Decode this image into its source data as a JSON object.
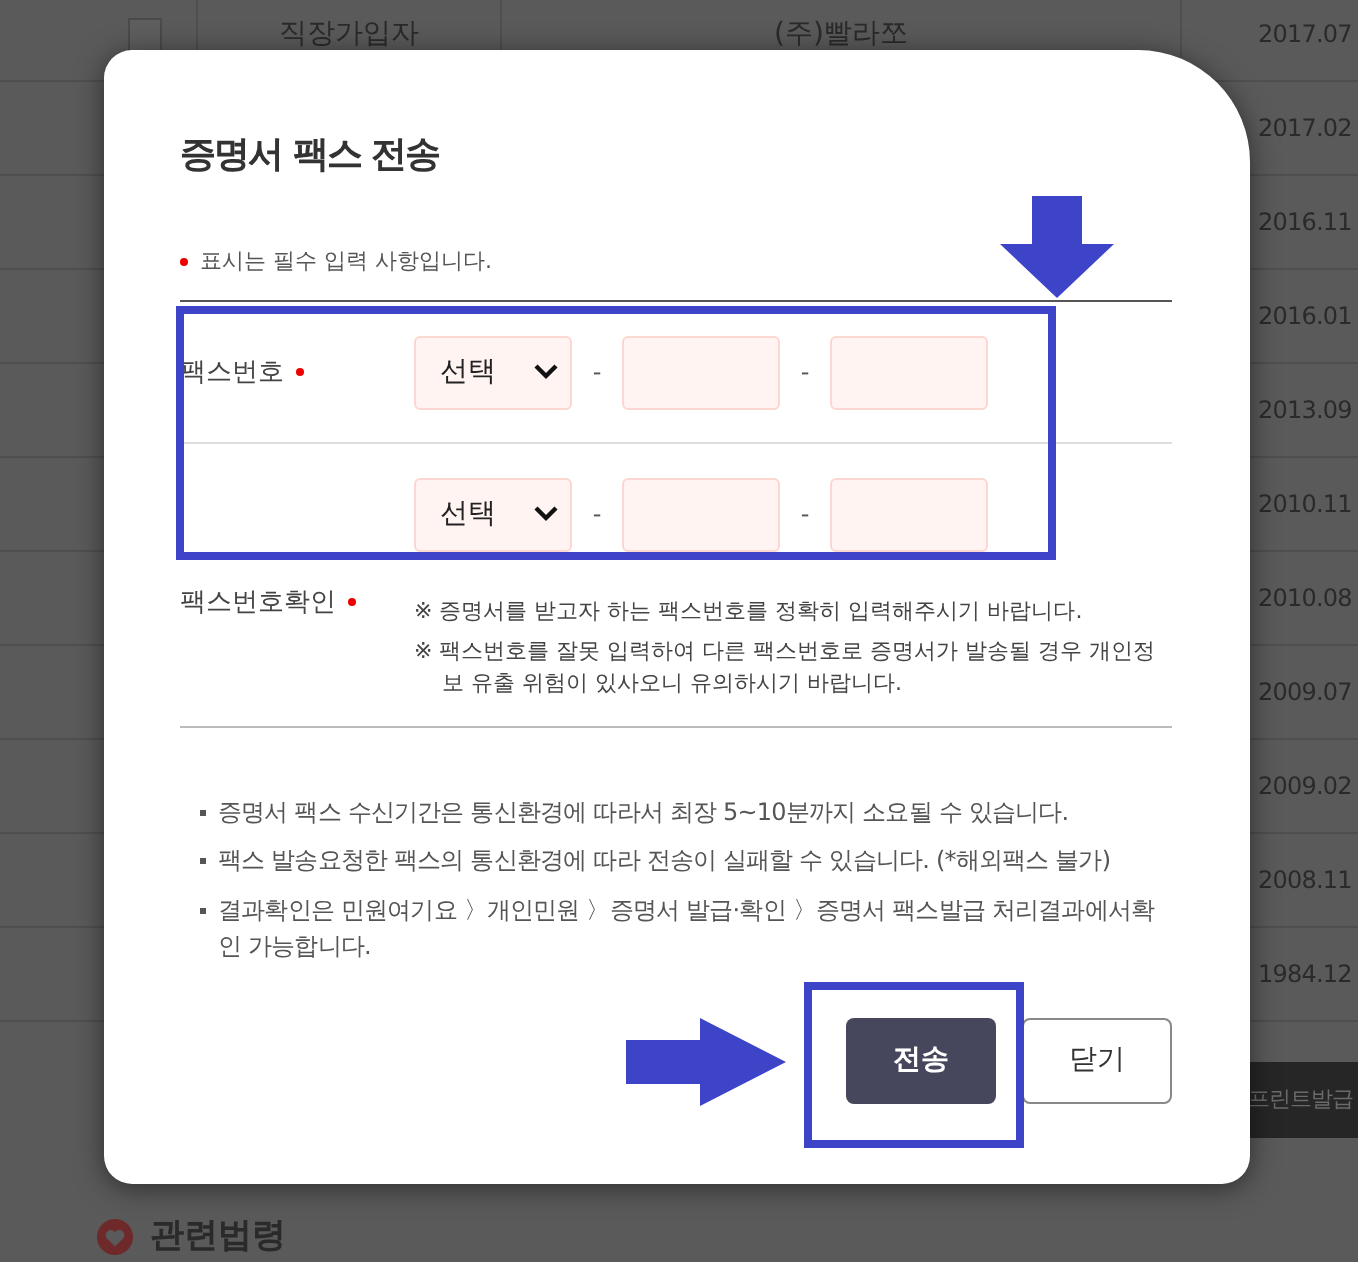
{
  "background": {
    "table_rows": [
      {
        "checked": false,
        "cells": [
          "직장가입자",
          "(주)빨라쪼",
          "2017.07"
        ]
      },
      {
        "cells": [
          "2017.02"
        ]
      },
      {
        "cells": [
          "2016.11"
        ]
      },
      {
        "cells": [
          "2016.01"
        ]
      },
      {
        "cells": [
          "2013.09"
        ]
      },
      {
        "cells": [
          "2010.11"
        ]
      },
      {
        "cells": [
          "2010.08"
        ]
      },
      {
        "cells": [
          "2009.07"
        ]
      },
      {
        "cells": [
          "2009.02"
        ]
      },
      {
        "cells": [
          "2008.11"
        ]
      },
      {
        "cells": [
          "1984.12"
        ]
      }
    ],
    "print_button": "프린트발급",
    "section_heading": "관련법령"
  },
  "modal": {
    "title": "증명서 팩스 전송",
    "required_note": "표시는 필수 입력 사항입니다.",
    "fields": [
      {
        "label": "팩스번호",
        "required": true,
        "select": "선택",
        "separator": "-",
        "separator_2": "-"
      },
      {
        "select": "선택",
        "separator": "-",
        "separator_2": "-"
      }
    ],
    "confirm_label": "팩스번호확인",
    "confirm_required": true,
    "notes": [
      "※ 증명서를 받고자 하는 팩스번호를 정확히 입력해주시기 바랍니다.",
      "※ 팩스번호를 잘못 입력하여 다른 팩스번호로 증명서가 발송될 경우 개인정보 유출 위험이 있사오니 유의하시기 바랍니다."
    ],
    "info": [
      "증명서 팩스 수신기간은 통신환경에 따라서 최장 5~10분까지 소요될 수 있습니다.",
      "팩스 발송요청한 팩스의 통신환경에 따라 전송이 실패할 수 있습니다. (*해외팩스 불가)",
      "결과확인은 민원여기요 〉개인민원 〉증명서 발급·확인 〉증명서 팩스발급 처리결과에서확인 가능합니다."
    ],
    "buttons": [
      {
        "kind": "primary",
        "label": "전송"
      },
      {
        "kind": "secondary",
        "label": "닫기"
      }
    ]
  }
}
